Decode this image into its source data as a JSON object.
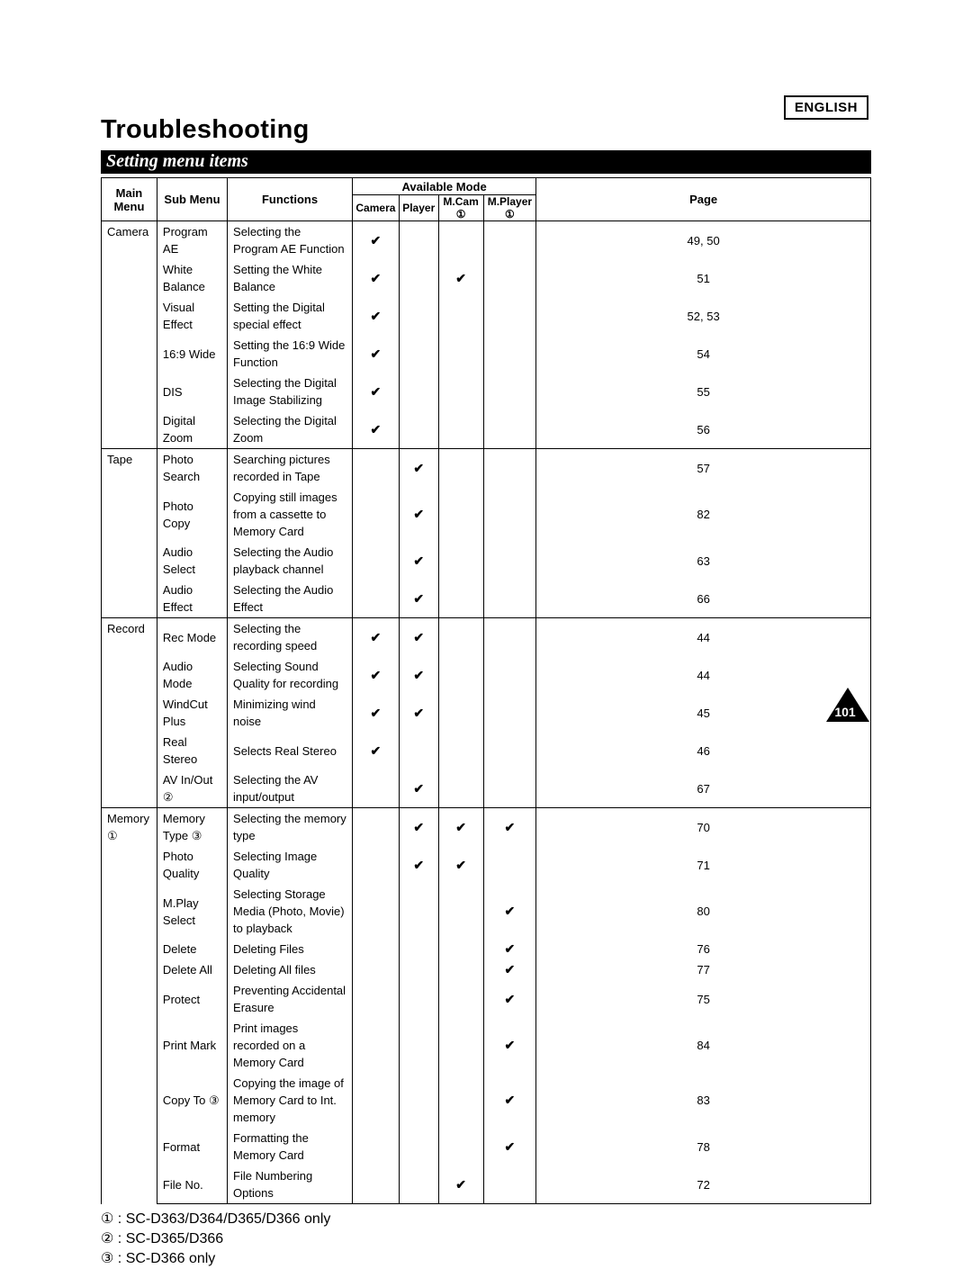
{
  "header": {
    "language": "ENGLISH",
    "title": "Troubleshooting",
    "section": "Setting menu items"
  },
  "glyph": {
    "c1": "①",
    "c2": "②",
    "c3": "③",
    "check": "✔"
  },
  "table": {
    "headers": {
      "main": "Main Menu",
      "sub": "Sub Menu",
      "func": "Functions",
      "modes": "Available Mode",
      "camera": "Camera",
      "player": "Player",
      "mcam": "M.Cam",
      "mplayer": "M.Player",
      "page": "Page"
    },
    "groups": [
      {
        "main": "Camera",
        "mainNote": null,
        "rows": [
          {
            "sub": "Program AE",
            "subNote": null,
            "func": "Selecting the Program AE Function",
            "camera": true,
            "player": false,
            "mcam": false,
            "mplayer": false,
            "page": "49, 50"
          },
          {
            "sub": "White Balance",
            "subNote": null,
            "func": "Setting the White Balance",
            "camera": true,
            "player": false,
            "mcam": true,
            "mplayer": false,
            "page": "51"
          },
          {
            "sub": "Visual Effect",
            "subNote": null,
            "func": "Setting the Digital special effect",
            "camera": true,
            "player": false,
            "mcam": false,
            "mplayer": false,
            "page": "52, 53"
          },
          {
            "sub": "16:9 Wide",
            "subNote": null,
            "func": "Setting the 16:9 Wide Function",
            "camera": true,
            "player": false,
            "mcam": false,
            "mplayer": false,
            "page": "54"
          },
          {
            "sub": "DIS",
            "subNote": null,
            "func": "Selecting the Digital Image Stabilizing",
            "camera": true,
            "player": false,
            "mcam": false,
            "mplayer": false,
            "page": "55"
          },
          {
            "sub": "Digital Zoom",
            "subNote": null,
            "func": "Selecting the Digital Zoom",
            "camera": true,
            "player": false,
            "mcam": false,
            "mplayer": false,
            "page": "56"
          }
        ]
      },
      {
        "main": "Tape",
        "mainNote": null,
        "rows": [
          {
            "sub": "Photo Search",
            "subNote": null,
            "func": "Searching pictures recorded in Tape",
            "camera": false,
            "player": true,
            "mcam": false,
            "mplayer": false,
            "page": "57"
          },
          {
            "sub": "Photo Copy",
            "subNote": null,
            "func": "Copying still images from a cassette to Memory Card",
            "camera": false,
            "player": true,
            "mcam": false,
            "mplayer": false,
            "page": "82"
          },
          {
            "sub": "Audio Select",
            "subNote": null,
            "func": "Selecting the Audio playback channel",
            "camera": false,
            "player": true,
            "mcam": false,
            "mplayer": false,
            "page": "63"
          },
          {
            "sub": "Audio Effect",
            "subNote": null,
            "func": "Selecting the Audio Effect",
            "camera": false,
            "player": true,
            "mcam": false,
            "mplayer": false,
            "page": "66"
          }
        ]
      },
      {
        "main": "Record",
        "mainNote": null,
        "rows": [
          {
            "sub": "Rec Mode",
            "subNote": null,
            "func": "Selecting the recording speed",
            "camera": true,
            "player": true,
            "mcam": false,
            "mplayer": false,
            "page": "44"
          },
          {
            "sub": "Audio Mode",
            "subNote": null,
            "func": "Selecting Sound Quality for recording",
            "camera": true,
            "player": true,
            "mcam": false,
            "mplayer": false,
            "page": "44"
          },
          {
            "sub": "WindCut Plus",
            "subNote": null,
            "func": "Minimizing wind noise",
            "camera": true,
            "player": true,
            "mcam": false,
            "mplayer": false,
            "page": "45"
          },
          {
            "sub": "Real Stereo",
            "subNote": null,
            "func": "Selects Real Stereo",
            "camera": true,
            "player": false,
            "mcam": false,
            "mplayer": false,
            "page": "46"
          },
          {
            "sub": "AV In/Out",
            "subNote": "②",
            "func": "Selecting the AV input/output",
            "camera": false,
            "player": true,
            "mcam": false,
            "mplayer": false,
            "page": "67"
          }
        ]
      },
      {
        "main": "Memory",
        "mainNote": "①",
        "rows": [
          {
            "sub": "Memory Type",
            "subNote": "③",
            "func": "Selecting the memory type",
            "camera": false,
            "player": true,
            "mcam": true,
            "mplayer": true,
            "page": "70"
          },
          {
            "sub": "Photo Quality",
            "subNote": null,
            "func": "Selecting Image Quality",
            "camera": false,
            "player": true,
            "mcam": true,
            "mplayer": false,
            "page": "71"
          },
          {
            "sub": "M.Play Select",
            "subNote": null,
            "func": "Selecting Storage Media (Photo, Movie) to playback",
            "camera": false,
            "player": false,
            "mcam": false,
            "mplayer": true,
            "page": "80"
          },
          {
            "sub": "Delete",
            "subNote": null,
            "func": "Deleting Files",
            "camera": false,
            "player": false,
            "mcam": false,
            "mplayer": true,
            "page": "76"
          },
          {
            "sub": "Delete All",
            "subNote": null,
            "func": "Deleting All files",
            "camera": false,
            "player": false,
            "mcam": false,
            "mplayer": true,
            "page": "77"
          },
          {
            "sub": "Protect",
            "subNote": null,
            "func": "Preventing Accidental Erasure",
            "camera": false,
            "player": false,
            "mcam": false,
            "mplayer": true,
            "page": "75"
          },
          {
            "sub": "Print Mark",
            "subNote": null,
            "func": "Print images recorded on a Memory Card",
            "camera": false,
            "player": false,
            "mcam": false,
            "mplayer": true,
            "page": "84"
          },
          {
            "sub": "Copy To",
            "subNote": "③",
            "func": "Copying the image of Memory Card to Int. memory",
            "camera": false,
            "player": false,
            "mcam": false,
            "mplayer": true,
            "page": "83"
          },
          {
            "sub": "Format",
            "subNote": null,
            "func": "Formatting the Memory Card",
            "camera": false,
            "player": false,
            "mcam": false,
            "mplayer": true,
            "page": "78"
          },
          {
            "sub": "File No.",
            "subNote": null,
            "func": "File Numbering Options",
            "camera": false,
            "player": false,
            "mcam": true,
            "mplayer": false,
            "page": "72"
          }
        ]
      }
    ]
  },
  "footnotes": [
    "SC-D363/D364/D365/D366 only",
    "SC-D365/D366",
    "SC-D366 only"
  ],
  "pageNumber": "101"
}
